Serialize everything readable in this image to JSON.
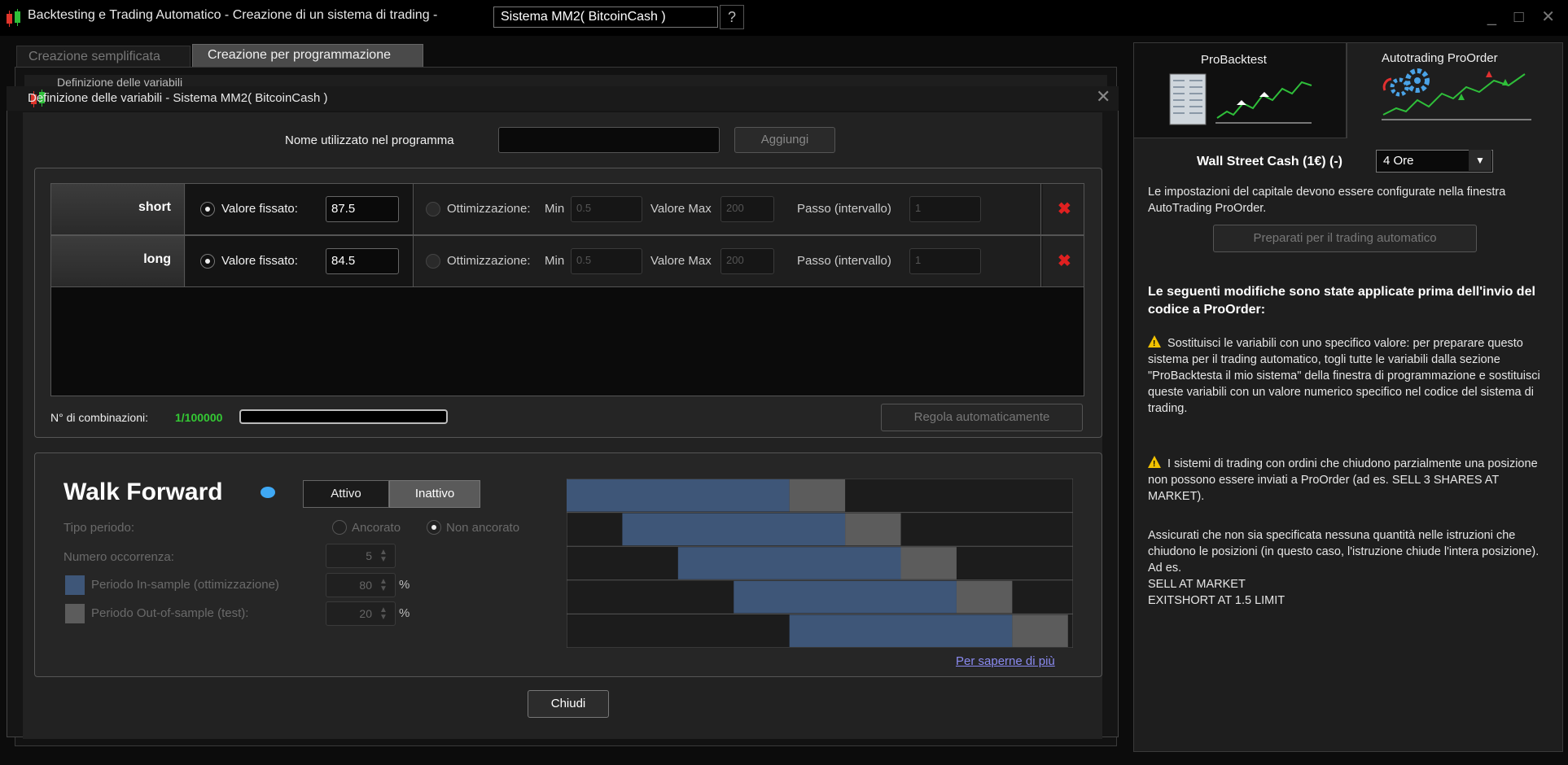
{
  "window": {
    "title": "Backtesting e Trading Automatico - Creazione di un sistema di trading  -",
    "system_combo": "Sistema MM2( BitcoinCash )",
    "help_icon": "question-document-icon",
    "controls": "_ □ ✕"
  },
  "left_tabs": {
    "simple": "Creazione semplificata",
    "programming": "Creazione per programmazione"
  },
  "background_bar": "Definizione delle variabili",
  "dialog": {
    "title": "Definizione delle variabili - Sistema MM2( BitcoinCash )",
    "close": "✕",
    "name_label": "Nome utilizzato nel programma",
    "name_value": "",
    "add_label": "Aggiungi",
    "variables": [
      {
        "name": "short",
        "fixed_label": "Valore fissato:",
        "fixed_value": "87.5",
        "opt_label": "Ottimizzazione:",
        "min_label": "Min",
        "min_value": "0.5",
        "max_label": "Valore Max",
        "max_value": "200",
        "step_label": "Passo (intervallo)",
        "step_value": "1"
      },
      {
        "name": "long",
        "fixed_label": "Valore fissato:",
        "fixed_value": "84.5",
        "opt_label": "Ottimizzazione:",
        "min_label": "Min",
        "min_value": "0.5",
        "max_label": "Valore Max",
        "max_value": "200",
        "step_label": "Passo (intervallo)",
        "step_value": "1"
      }
    ],
    "combinations_label": "N° di combinazioni:",
    "combinations_value": "1/100000",
    "auto_adjust_label": "Regola automaticamente",
    "walk_forward": {
      "title": "Walk Forward",
      "active_label": "Attivo",
      "inactive_label": "Inattivo",
      "period_type_label": "Tipo periodo:",
      "anchored_label": "Ancorato",
      "not_anchored_label": "Non ancorato",
      "occurrences_label": "Numero occorrenza:",
      "occurrences_value": "5",
      "insample_label": "Periodo In-sample (ottimizzazione)",
      "insample_value": "80",
      "outsample_label": "Periodo Out-of-sample (test):",
      "outsample_value": "20",
      "percent": "%",
      "insample_color": "#3e5678",
      "outsample_color": "#5c5c5c",
      "more_link": "Per saperne di più"
    },
    "close_label": "Chiudi"
  },
  "right_panel": {
    "tab_backtest": "ProBacktest",
    "tab_autotrading": "Autotrading ProOrder",
    "instrument_label": "Wall Street Cash (1€) (-)",
    "timeframe_value": "4 Ore",
    "capital_note": "Le impostazioni del capitale devono essere configurate nella finestra AutoTrading ProOrder.",
    "prepare_label": "Preparati per il trading automatico",
    "changes_heading": "Le seguenti modifiche sono state applicate prima dell'invio del codice a ProOrder:",
    "paragraph_1": "Sostituisci le variabili con uno specifico valore: per preparare questo sistema per il trading automatico, togli tutte le variabili dalla sezione \"ProBacktesta il mio sistema\" della finestra di programmazione e sostituisci queste variabili con un valore numerico specifico nel codice del sistema di trading.",
    "paragraph_2": "I sistemi di trading con ordini che chiudono parzialmente una posizione non possono essere inviati a ProOrder (ad es. SELL 3 SHARES AT MARKET).",
    "paragraph_3_lines": [
      "Assicurati che non sia specificata nessuna quantità nelle istruzioni che chiudono le posizioni (in questo caso, l'istruzione chiude l'intera posizione). Ad es.",
      "SELL AT MARKET",
      "EXITSHORT AT 1.5 LIMIT"
    ]
  }
}
